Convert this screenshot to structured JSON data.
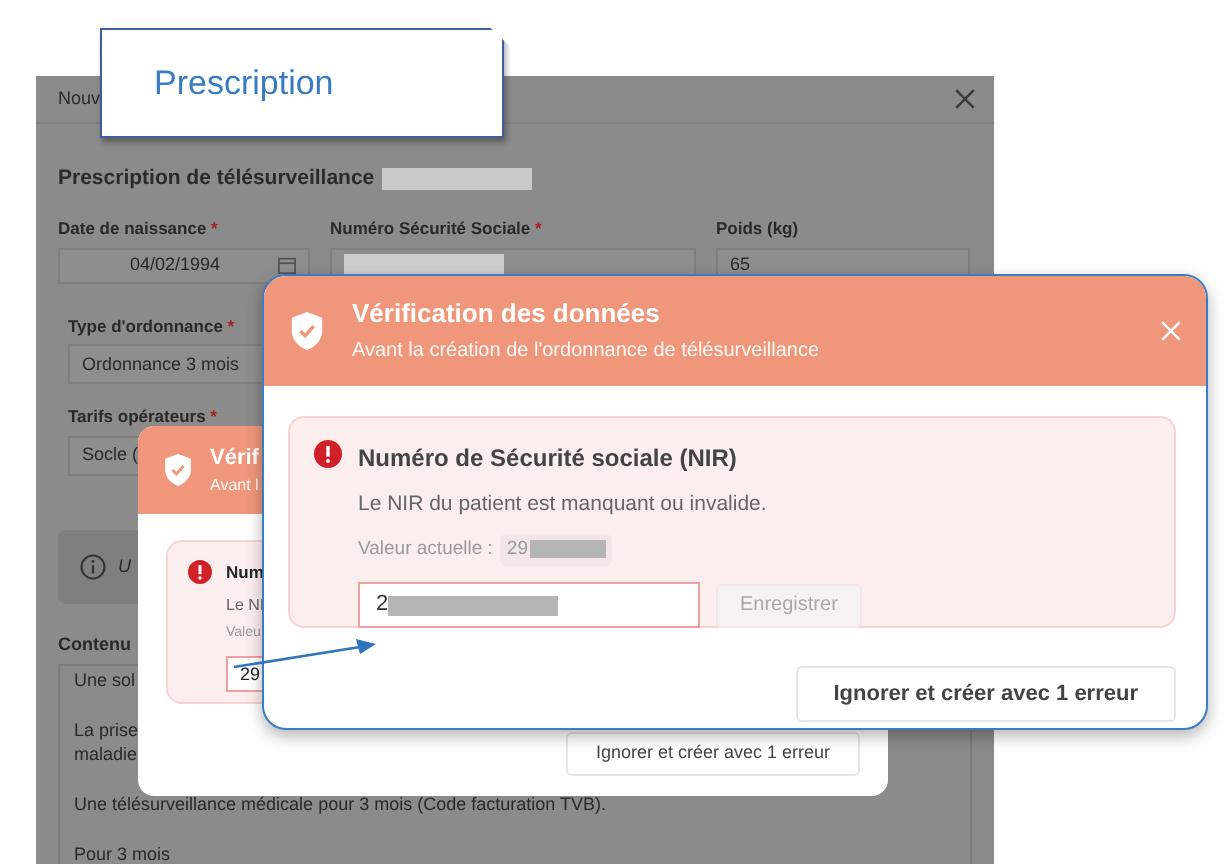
{
  "callout": {
    "text": "Prescription"
  },
  "background_window": {
    "title": "Nouv",
    "heading": "Prescription de télésurveillance",
    "heading_redacted": true,
    "fields": [
      {
        "label": "Date de naissance",
        "required_mark": "*",
        "value": "04/02/1994",
        "kind": "date"
      },
      {
        "label": "Numéro Sécurité Sociale",
        "required_mark": "*",
        "redacted": true,
        "kind": "text"
      },
      {
        "label": "Poids (kg)",
        "value": "65",
        "kind": "text"
      }
    ],
    "selects": [
      {
        "label": "Type d'ordonnance",
        "required_mark": "*",
        "value": "Ordonnance 3 mois"
      },
      {
        "label": "Tarifs opérateurs",
        "required_mark": "*",
        "value": "Socle ("
      }
    ],
    "info": {
      "text": "U"
    },
    "content": {
      "label": "Contenu",
      "paragraphs": [
        [
          "Une sol"
        ],
        [
          "La prise",
          "maladie"
        ],
        [
          "Une télésurveillance médicale pour 3 mois (Code facturation TVB)."
        ],
        [
          "Pour 3 mois"
        ]
      ]
    }
  },
  "back_modal": {
    "title": "Vérif",
    "subtitle": "Avant l",
    "error": {
      "title": "Num",
      "message": "Le NI",
      "current_label": "Valeu",
      "input_value": "29"
    },
    "footer_button": "Ignorer et créer avec 1 erreur"
  },
  "front_modal": {
    "title": "Vérification des données",
    "subtitle": "Avant la création de l'ordonnance de télésurveillance",
    "error": {
      "title": "Numéro de Sécurité sociale (NIR)",
      "message": "Le NIR du patient est manquant ou invalide.",
      "current_label": "Valeur actuelle :",
      "current_value": "29",
      "current_redacted": true,
      "input_value": "2",
      "input_redacted": true,
      "save_button": {
        "label": "Enregistrer",
        "disabled": true
      }
    },
    "footer_button": "Ignorer et créer avec 1 erreur"
  }
}
